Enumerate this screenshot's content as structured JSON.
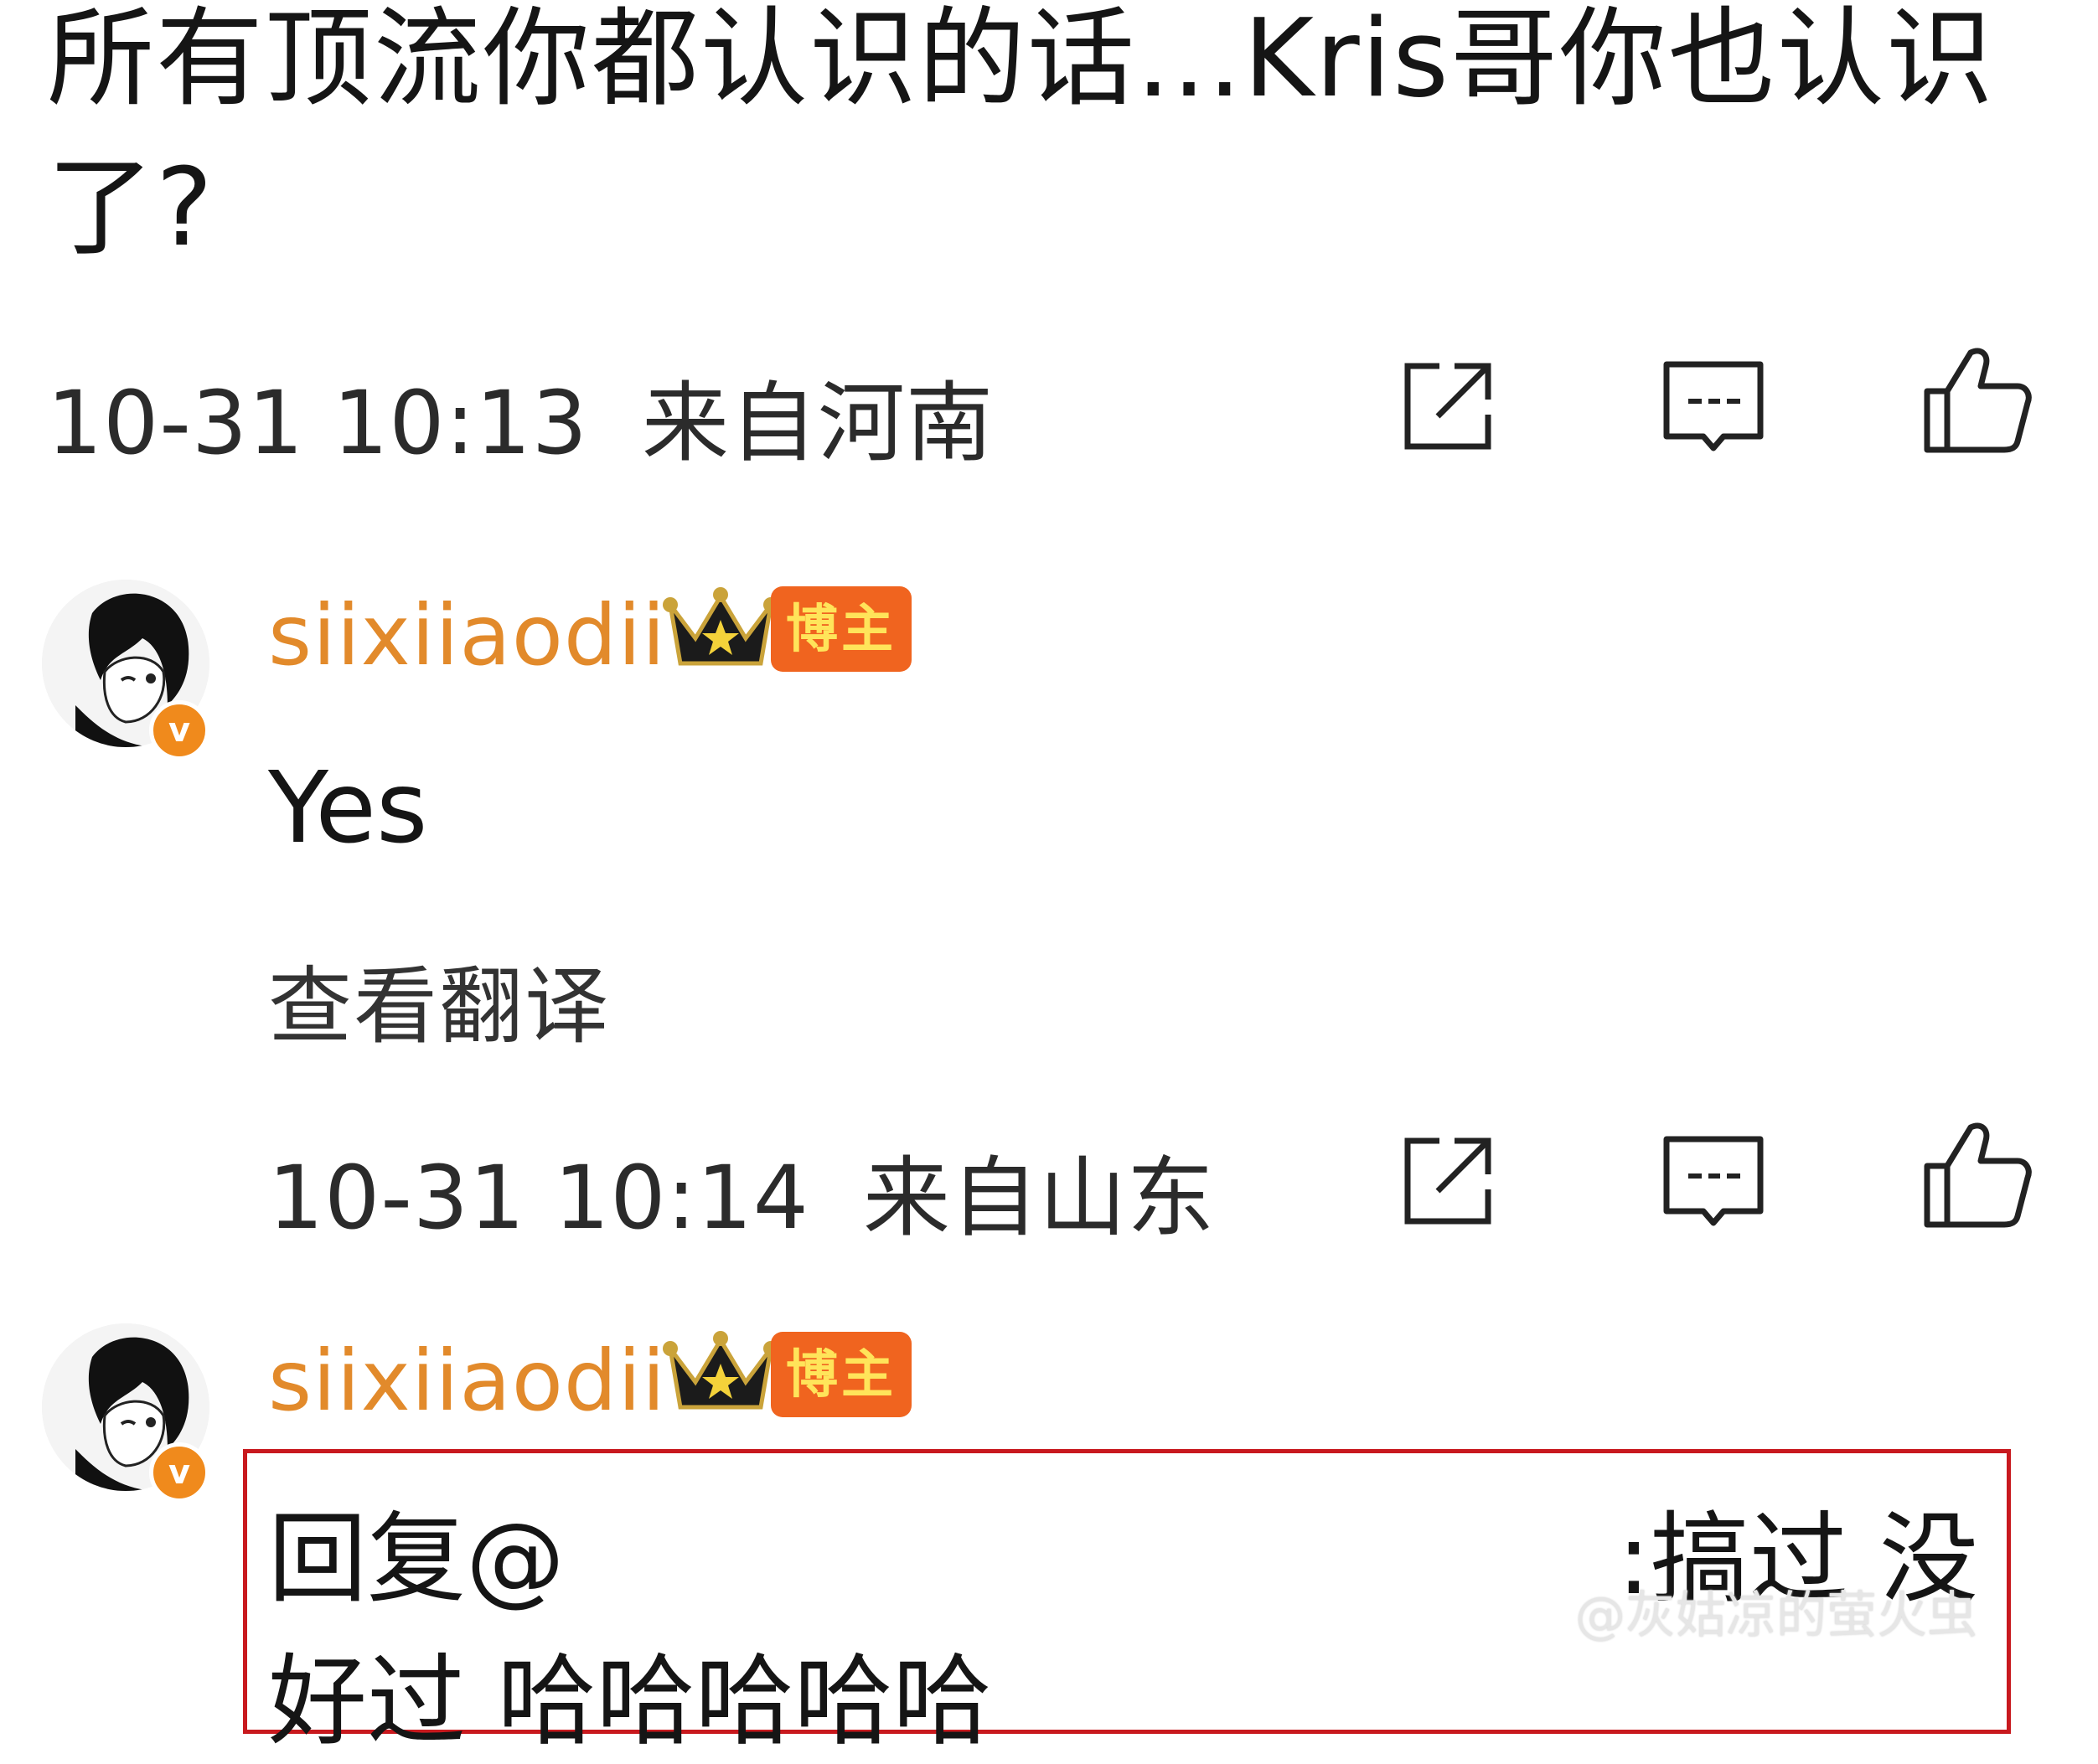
{
  "post": {
    "text": "所有顶流你都认识的话...Kris哥你也认识了?",
    "timestamp": "10-31 10:13",
    "location": "来自河南"
  },
  "replies": [
    {
      "username": "siixiiaodii",
      "tag": "博主",
      "text": "Yes",
      "translate_label": "查看翻译",
      "timestamp": "10-31 10:14",
      "location": "来自山东"
    },
    {
      "username": "siixiiaodii",
      "tag": "博主",
      "quote_prefix": "回复@",
      "quote_right": ":搞过 没",
      "quote_line2": "好过 哈哈哈哈哈"
    }
  ],
  "actions": {
    "share_icon": "share-icon",
    "comment_icon": "comment-icon",
    "like_icon": "thumbs-up-icon"
  },
  "watermark": "@灰姑凉的萤火虫",
  "colors": {
    "username": "#e28a2b",
    "tag_bg": "#f0641f",
    "tag_text": "#ffe45a",
    "highlight_box": "#c8191e"
  }
}
